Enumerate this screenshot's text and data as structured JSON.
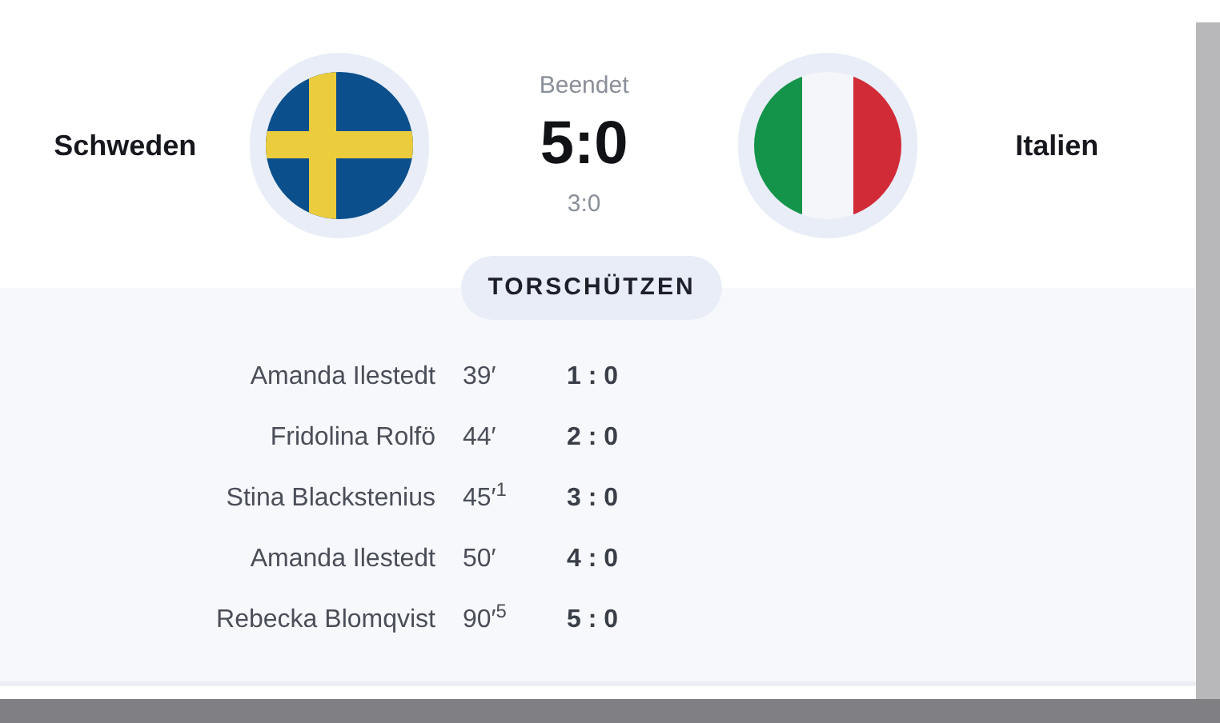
{
  "match": {
    "status": "Beendet",
    "score": "5:0",
    "halftime": "3:0",
    "home": {
      "name": "Schweden",
      "flag": {
        "kind": "sweden"
      }
    },
    "away": {
      "name": "Italien",
      "flag": {
        "kind": "italy"
      }
    }
  },
  "scorers": {
    "title": "TORSCHÜTZEN",
    "goals": [
      {
        "player": "Amanda Ilestedt",
        "minute": "39′",
        "score": "1 : 0"
      },
      {
        "player": "Fridolina Rolfö",
        "minute": "44′",
        "score": "2 : 0"
      },
      {
        "player": "Stina Blackstenius",
        "minute": "45′$^{1}$",
        "score": "3 : 0"
      },
      {
        "player": "Amanda Ilestedt",
        "minute": "50′",
        "score": "4 : 0"
      },
      {
        "player": "Rebecka Blomqvist",
        "minute": "90′$^{5}$",
        "score": "5 : 0"
      }
    ]
  }
}
